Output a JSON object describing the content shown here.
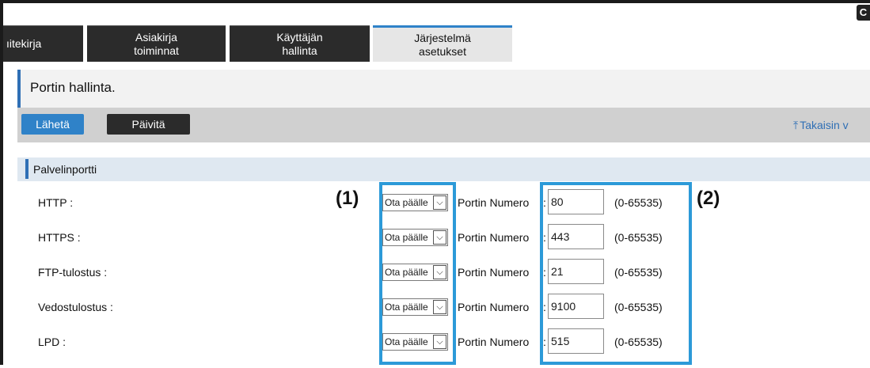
{
  "tabs": [
    {
      "label": "ıitekirja"
    },
    {
      "label": "Asiakirja\ntoiminnat"
    },
    {
      "label": "Käyttäjän\nhallinta"
    },
    {
      "label": "Järjestelmä\nasetukset"
    }
  ],
  "page_title": "Portin hallinta.",
  "actions": {
    "send_label": "Lähetä",
    "refresh_label": "Päivitä",
    "back_label": "Takaisin v"
  },
  "section_title": "Palvelinportti",
  "callouts": {
    "left": "(1)",
    "right": "(2)"
  },
  "port_label": "Portin Numero",
  "colon": ":",
  "rows": [
    {
      "label": "HTTP :",
      "state": "Ota päälle",
      "port": "80",
      "range": "(0-65535)"
    },
    {
      "label": "HTTPS :",
      "state": "Ota päälle",
      "port": "443",
      "range": "(0-65535)"
    },
    {
      "label": "FTP-tulostus :",
      "state": "Ota päälle",
      "port": "21",
      "range": "(0-65535)"
    },
    {
      "label": "Vedostulostus :",
      "state": "Ota päälle",
      "port": "9100",
      "range": "(0-65535)"
    },
    {
      "label": "LPD :",
      "state": "Ota päälle",
      "port": "515",
      "range": "(0-65535)"
    }
  ],
  "colors": {
    "accent": "#2f82c8",
    "highlight": "#2c9ad8",
    "tab_dark": "#2b2b2b"
  }
}
